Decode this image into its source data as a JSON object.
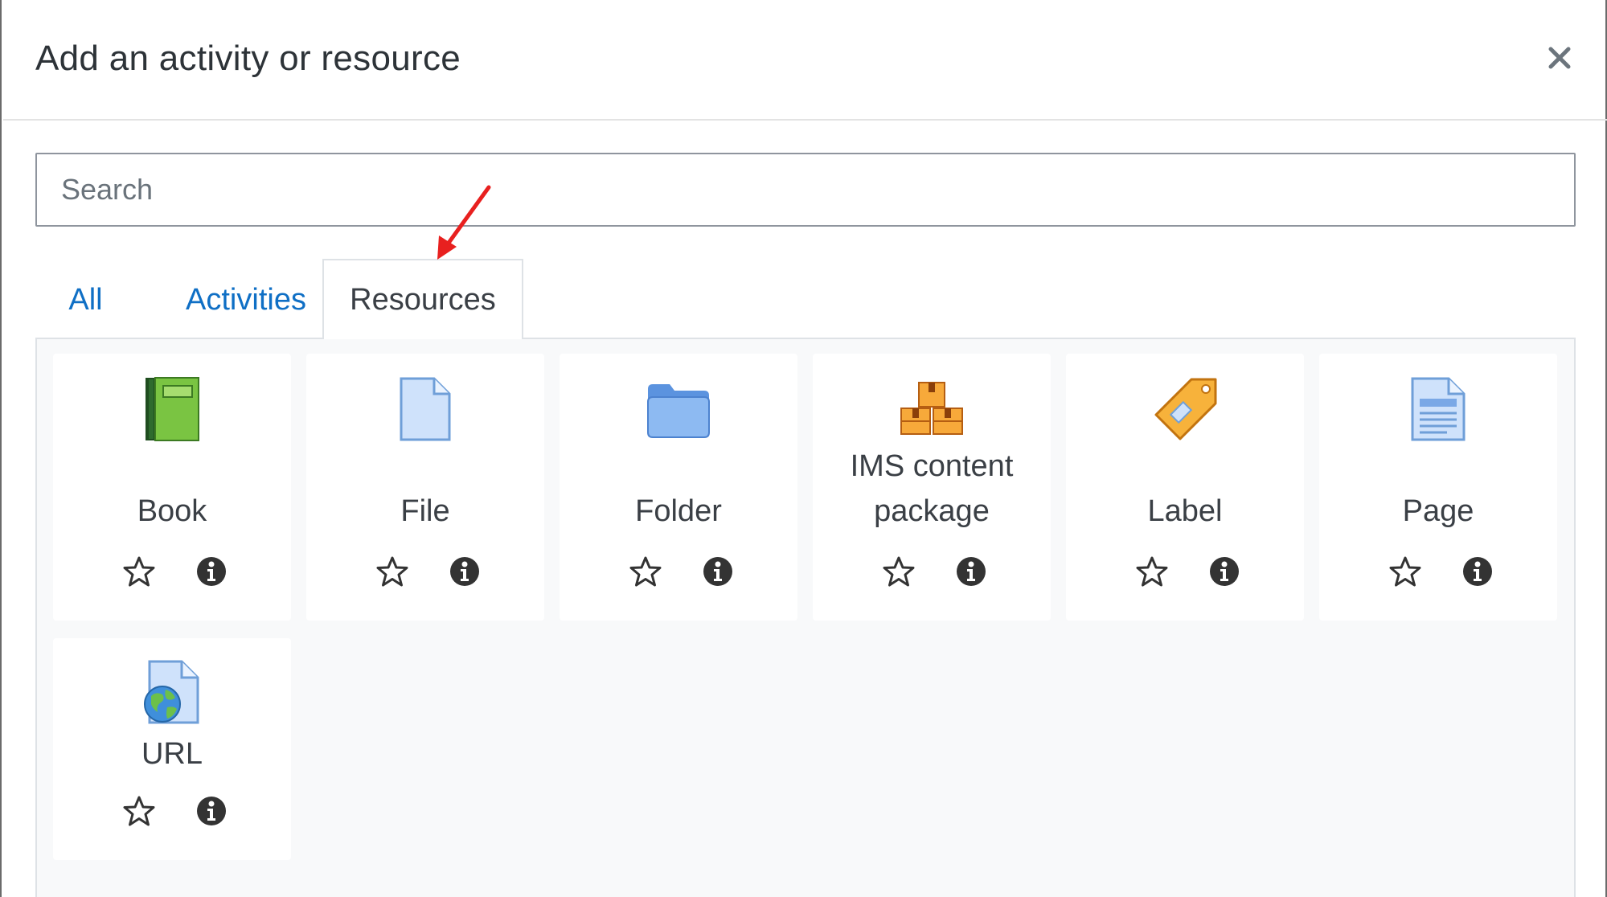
{
  "modal": {
    "title": "Add an activity or resource"
  },
  "search": {
    "placeholder": "Search"
  },
  "tabs": [
    {
      "label": "All"
    },
    {
      "label": "Activities"
    },
    {
      "label": "Resources"
    }
  ],
  "active_tab": "Resources",
  "items": [
    {
      "label": "Book",
      "icon": "book-icon"
    },
    {
      "label": "File",
      "icon": "file-icon"
    },
    {
      "label": "Folder",
      "icon": "folder-icon"
    },
    {
      "label": "IMS content package",
      "icon": "ims-package-icon"
    },
    {
      "label": "Label",
      "icon": "label-tag-icon"
    },
    {
      "label": "Page",
      "icon": "page-icon"
    },
    {
      "label": "URL",
      "icon": "url-globe-icon"
    }
  ],
  "colors": {
    "link_blue": "#0f6fc5",
    "content_bg": "#f8f9fa",
    "annotation_arrow": "#e8201f"
  }
}
